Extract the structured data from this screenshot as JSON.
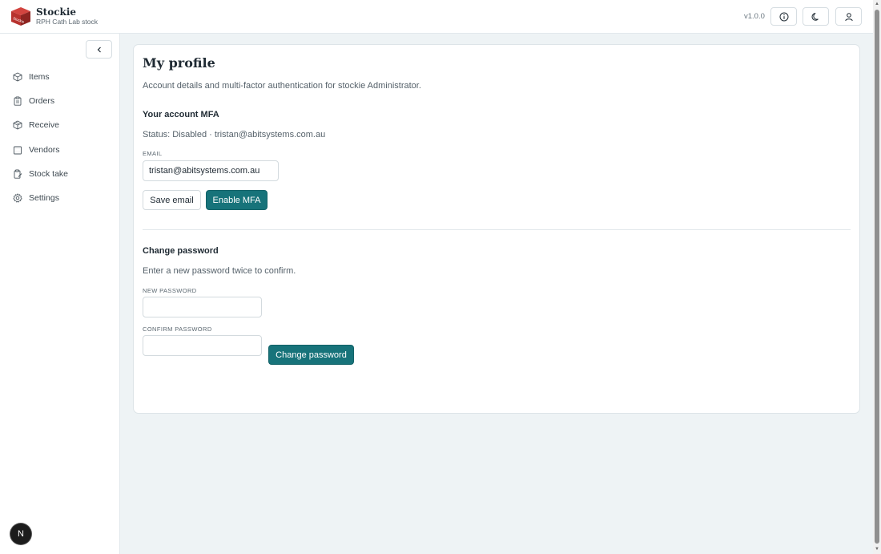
{
  "app": {
    "name": "Stockie",
    "subtitle": "RPH Cath Lab stock",
    "logo_text": "Stockie",
    "version": "v1.0.0"
  },
  "header": {
    "buttons": [
      {
        "icon": "info-icon"
      },
      {
        "icon": "moon-icon"
      },
      {
        "icon": "user-icon"
      }
    ]
  },
  "sidebar": {
    "items": [
      {
        "label": "Items",
        "icon": "cube-icon"
      },
      {
        "label": "Orders",
        "icon": "clipboard-icon"
      },
      {
        "label": "Receive",
        "icon": "package-icon"
      },
      {
        "label": "Vendors",
        "icon": "building-icon"
      },
      {
        "label": "Stock take",
        "icon": "clipboard-edit-icon"
      },
      {
        "label": "Settings",
        "icon": "gear-icon"
      }
    ],
    "avatar_letter": "N"
  },
  "profile": {
    "title": "My profile",
    "description": "Account details and multi-factor authentication for stockie Administrator.",
    "mfa": {
      "title": "Your account MFA",
      "status": "Status: Disabled · tristan@abitsystems.com.au",
      "email_label": "EMAIL",
      "email_value": "tristan@abitsystems.com.au",
      "save_label": "Save email",
      "enable_label": "Enable MFA"
    },
    "password": {
      "title": "Change password",
      "hint": "Enter a new password twice to confirm.",
      "new_label": "NEW PASSWORD",
      "new_value": "",
      "confirm_label": "CONFIRM PASSWORD",
      "confirm_value": "",
      "submit_label": "Change password"
    }
  },
  "colors": {
    "primary": "#17737a",
    "background": "#eef3f5",
    "logo": "#b8322e"
  }
}
